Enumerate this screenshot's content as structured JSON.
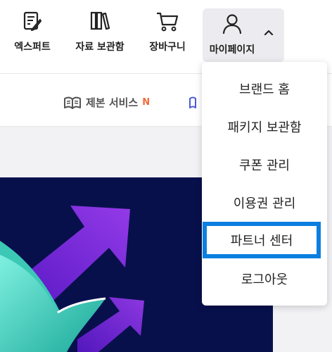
{
  "header": {
    "nav": {
      "expert": {
        "label": "엑스퍼트",
        "icon": "pencil-document-icon"
      },
      "library": {
        "label": "자료 보관함",
        "icon": "books-icon"
      },
      "cart": {
        "label": "장바구니",
        "icon": "cart-icon"
      },
      "mypage": {
        "label": "마이페이지",
        "icon": "user-icon",
        "expanded": true
      }
    }
  },
  "subnav": {
    "service_label": "제본 서비스",
    "service_badge": "N",
    "service_icon": "open-book-icon"
  },
  "dropdown": {
    "items": [
      {
        "label": "브랜드 홈"
      },
      {
        "label": "패키지 보관함"
      },
      {
        "label": "쿠폰 관리"
      },
      {
        "label": "이용권 관리"
      },
      {
        "label": "파트너 센터",
        "highlighted": true
      },
      {
        "label": "로그아웃"
      }
    ]
  },
  "colors": {
    "highlight_border": "#0a7fe0",
    "badge": "#f06a3c",
    "banner_bg": "#08104c",
    "arrow_purple": "#8a2be2",
    "book_teal": "#2dd4c0"
  }
}
